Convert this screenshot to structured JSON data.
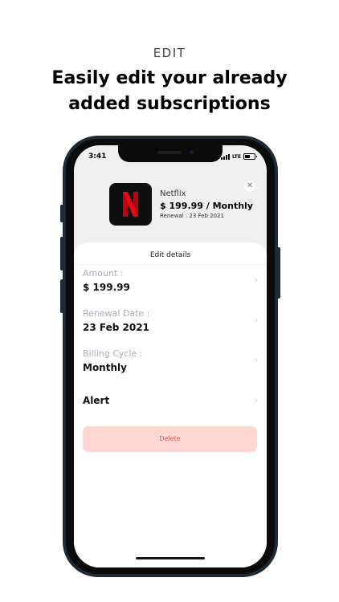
{
  "promo": {
    "section_label": "EDIT",
    "headline_line1": "Easily edit your already",
    "headline_line2": "added subscriptions"
  },
  "status_bar": {
    "time": "3:41",
    "network": "LTE"
  },
  "subscription": {
    "logo_letter": "N",
    "name": "Netflix",
    "price_line": "$ 199.99 / Monthly",
    "renewal_line": "Renewal : 23 Feb 2021",
    "close_glyph": "✕"
  },
  "sheet": {
    "title": "Edit details",
    "rows": [
      {
        "label": "Amount :",
        "value": "$ 199.99"
      },
      {
        "label": "Renewal Date :",
        "value": "23 Feb 2021"
      },
      {
        "label": "Billing Cycle :",
        "value": "Monthly"
      },
      {
        "label": "",
        "value": "Alert"
      }
    ],
    "chevron_glyph": "›",
    "delete_label": "Delete"
  },
  "colors": {
    "logo_red": "#e50914",
    "delete_bg": "#ffd6d2",
    "delete_text": "#d95c4f"
  }
}
